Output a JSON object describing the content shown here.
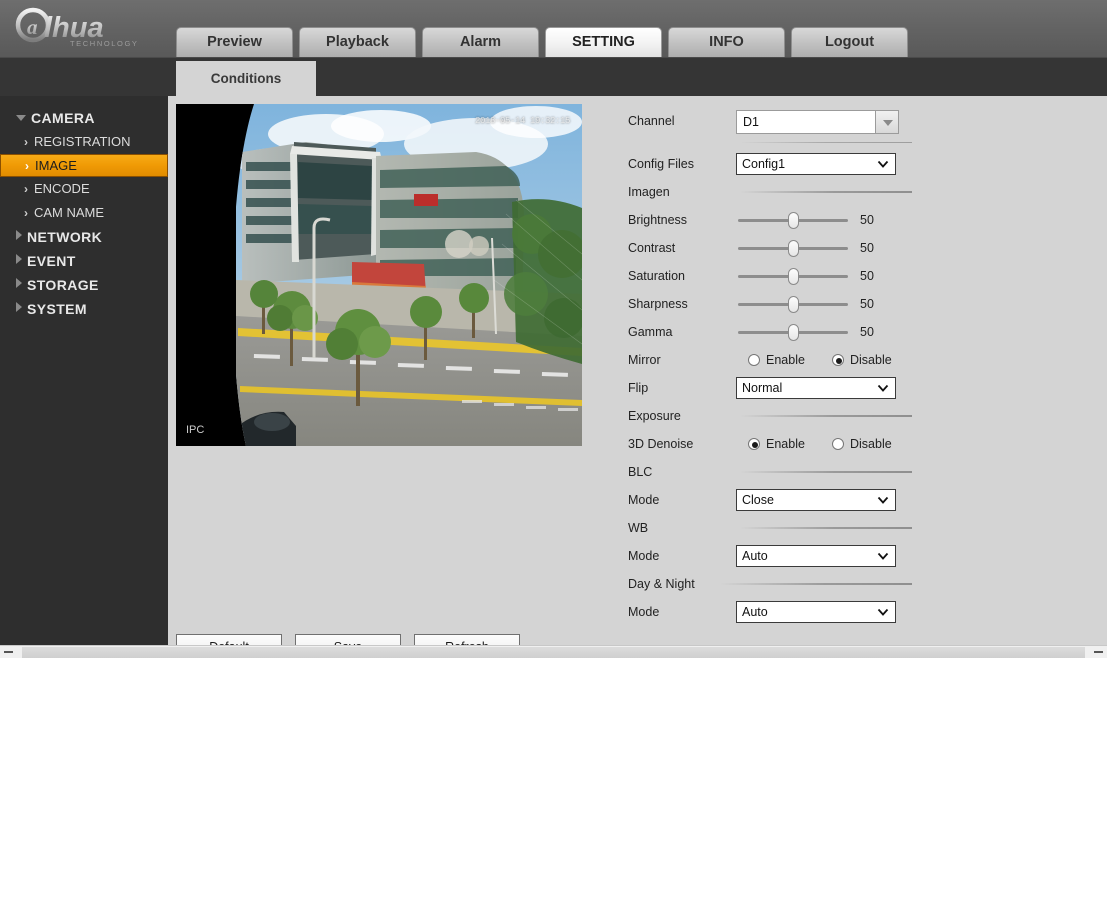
{
  "header": {
    "brand": "alhua",
    "brand_sub": "TECHNOLOGY",
    "nav_tabs": [
      {
        "label": "Preview",
        "active": false
      },
      {
        "label": "Playback",
        "active": false
      },
      {
        "label": "Alarm",
        "active": false
      },
      {
        "label": "SETTING",
        "active": true
      },
      {
        "label": "INFO",
        "active": false
      },
      {
        "label": "Logout",
        "active": false
      }
    ]
  },
  "subbar": {
    "tab_label": "Conditions"
  },
  "sidebar": {
    "groups": [
      {
        "label": "CAMERA",
        "expanded": true,
        "items": [
          {
            "label": "REGISTRATION",
            "selected": false
          },
          {
            "label": "IMAGE",
            "selected": true
          },
          {
            "label": "ENCODE",
            "selected": false
          },
          {
            "label": "CAM NAME",
            "selected": false
          }
        ]
      },
      {
        "label": "NETWORK",
        "expanded": false,
        "items": []
      },
      {
        "label": "EVENT",
        "expanded": false,
        "items": []
      },
      {
        "label": "STORAGE",
        "expanded": false,
        "items": []
      },
      {
        "label": "SYSTEM",
        "expanded": false,
        "items": []
      }
    ]
  },
  "video": {
    "osd_timestamp": "2018-05-14 19:32:15",
    "osd_channel_name": "IPC"
  },
  "panel": {
    "channel": {
      "label": "Channel",
      "value": "D1"
    },
    "config_files": {
      "label": "Config Files",
      "value": "Config1"
    },
    "section_imagen": {
      "label": "Imagen"
    },
    "brightness": {
      "label": "Brightness",
      "value": "50",
      "percent": 50
    },
    "contrast": {
      "label": "Contrast",
      "value": "50",
      "percent": 50
    },
    "saturation": {
      "label": "Saturation",
      "value": "50",
      "percent": 50
    },
    "sharpness": {
      "label": "Sharpness",
      "value": "50",
      "percent": 50
    },
    "gamma": {
      "label": "Gamma",
      "value": "50",
      "percent": 50
    },
    "mirror": {
      "label": "Mirror",
      "enable_label": "Enable",
      "disable_label": "Disable",
      "selected": "Disable"
    },
    "flip": {
      "label": "Flip",
      "value": "Normal"
    },
    "section_exposure": {
      "label": "Exposure"
    },
    "denoise_3d": {
      "label": "3D Denoise",
      "enable_label": "Enable",
      "disable_label": "Disable",
      "selected": "Enable"
    },
    "section_blc": {
      "label": "BLC"
    },
    "blc_mode": {
      "label": "Mode",
      "value": "Close"
    },
    "section_wb": {
      "label": "WB"
    },
    "wb_mode": {
      "label": "Mode",
      "value": "Auto"
    },
    "section_day_night": {
      "label": "Day & Night"
    },
    "day_night_mode": {
      "label": "Mode",
      "value": "Auto"
    }
  },
  "actions": [
    {
      "label": "Default"
    },
    {
      "label": "Save"
    },
    {
      "label": "Refresh"
    }
  ],
  "colors": {
    "accent": "#f09a05",
    "sidebar_bg": "#2e2e2e",
    "panel_bg": "#d4d4d4",
    "header_bg": "#646464"
  }
}
